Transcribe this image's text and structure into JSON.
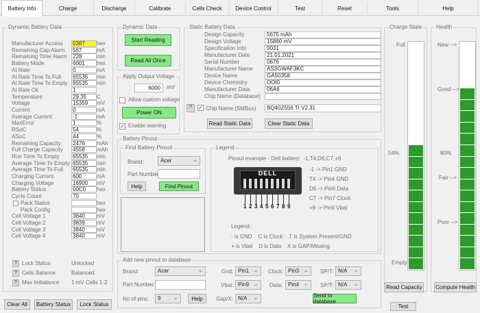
{
  "tabs": [
    "Battery Info",
    "Charge",
    "Discharge",
    "Calibrate",
    "Cells Check",
    "Device Control",
    "Test",
    "Reset",
    "Tools",
    "Help"
  ],
  "dynamic": {
    "title": "Dynamic Battery Data",
    "rows": [
      {
        "label": "Manufacturer Access",
        "value": "0387",
        "unit": "hex",
        "hl": true
      },
      {
        "label": "Remaining Cap Alarm",
        "value": "567",
        "unit": "mA"
      },
      {
        "label": "Remaining Time Alarm",
        "value": "228",
        "unit": "min"
      },
      {
        "label": "Battery Mode",
        "value": "6001",
        "unit": "hex"
      },
      {
        "label": "At Rate",
        "value": "0",
        "unit": "mA"
      },
      {
        "label": "At Rate Time To Full",
        "value": "65535",
        "unit": "min"
      },
      {
        "label": "At Rate Time To Empty",
        "value": "65535",
        "unit": "min"
      },
      {
        "label": "At Rate Ok",
        "value": "1",
        "unit": ""
      },
      {
        "label": "Temperature",
        "value": "29.35",
        "unit": "C"
      },
      {
        "label": "Voltage",
        "value": "15359",
        "unit": "mV"
      },
      {
        "label": "Current",
        "value": "0",
        "unit": "mA"
      },
      {
        "label": "Average Current",
        "value": "-1",
        "unit": "mA"
      },
      {
        "label": "MaxError",
        "value": "1",
        "unit": "%"
      },
      {
        "label": "RSoC",
        "value": "54",
        "unit": "%"
      },
      {
        "label": "ASoC",
        "value": "44",
        "unit": "%"
      },
      {
        "label": "Remaining Capacity",
        "value": "2476",
        "unit": "mAh"
      },
      {
        "label": "Full Charge Capacity",
        "value": "4558",
        "unit": "mAh"
      },
      {
        "label": "Run Time To Empty",
        "value": "65535",
        "unit": "min"
      },
      {
        "label": "Average Time To Empty",
        "value": "65535",
        "unit": "min"
      },
      {
        "label": "Average Time To Full",
        "value": "65535",
        "unit": "min"
      },
      {
        "label": "Charging Current",
        "value": "600",
        "unit": "mA"
      },
      {
        "label": "Charging Voltage",
        "value": "16900",
        "unit": "mV"
      },
      {
        "label": "Battery Status",
        "value": "00C0",
        "unit": "hex"
      },
      {
        "label": "Cycle Count",
        "value": "70",
        "unit": ""
      },
      {
        "label": "Pack Status",
        "value": "",
        "unit": "hex"
      },
      {
        "label": "Pack Config",
        "value": "",
        "unit": "hex"
      },
      {
        "label": "Cell Voltage 1",
        "value": "3840",
        "unit": "mV"
      },
      {
        "label": "Cell Voltage 2",
        "value": "3839",
        "unit": "mV"
      },
      {
        "label": "Cell Voltage 3",
        "value": "3840",
        "unit": "mV"
      },
      {
        "label": "Cell Voltage 4",
        "value": "3840",
        "unit": "mV"
      }
    ],
    "lock_status_label": "Lock Status",
    "lock_status_value": "Unlocked",
    "cells_balance_label": "Cells Balance",
    "cells_balance_value": "Balanced",
    "max_imbalance_label": "Max Imbalance",
    "max_imbalance_value": "1 mV Cells 1-2",
    "qmark": "?"
  },
  "bottom_buttons": {
    "clear_all": "Clear All",
    "battery_status": "Battery Status",
    "lock_status": "Lock Status"
  },
  "dyn_data": {
    "title": "Dynamic Data",
    "start": "Start Reading",
    "read_once": "Read All Once"
  },
  "apply_voltage": {
    "title": "Apply Output Voltage",
    "value": "6000",
    "unit": "mV",
    "allow_custom": "Allow custom voltage",
    "power_on": "Power ON",
    "enable_warning": "Enable warning"
  },
  "static": {
    "title": "Static Battery Data",
    "rows": [
      {
        "label": "Design Capacity",
        "value": "5675 mAh"
      },
      {
        "label": "Design Voltage",
        "value": "15860 mV"
      },
      {
        "label": "Specification Info",
        "value": "0031"
      },
      {
        "label": "Manufacturer Date",
        "value": "21.01.2021"
      },
      {
        "label": "Serial Number",
        "value": "0676"
      },
      {
        "label": "Manufacturer Name",
        "value": "AS3GWAF3KC"
      },
      {
        "label": "Device Name",
        "value": "GA50358"
      },
      {
        "label": "Device Chemistry",
        "value": "OOI0"
      },
      {
        "label": "Manufacturer Data",
        "value": "06A6"
      },
      {
        "label": "Chip Name (Database)",
        "value": ""
      }
    ],
    "chip_smbus_label": "Chip Name (SMBus)",
    "chip_smbus_value": "BQ40Z556 TI V2.31",
    "read_btn": "Read Static Data",
    "clear_btn": "Clear Static Data"
  },
  "pinout": {
    "title": "Battery Pinout",
    "find_title": "Find Battery Pinout",
    "brand_label": "Brand:",
    "brand_value": "Acer",
    "part_label": "Part Number:",
    "part_value": "",
    "help": "Help",
    "find": "Find Pinout",
    "legend_title": "Legend",
    "example": "Pinout example - Dell battery:  -1,T4,D6,C7,+9",
    "connector_label": "DELL",
    "pin_numbers": [
      "1",
      "2",
      "3",
      "4",
      "5",
      "6",
      "7",
      "8",
      "9"
    ],
    "pin_map": [
      "-1 -> Pin1 GND",
      "T4 -> Pin4 GND",
      "D6 -> Pin6 Data",
      "C7 -> Pin7 Clock",
      "+9 -> Pin9 Vbat"
    ],
    "legend_head": "Legend:",
    "legend_lines": [
      "- is GND    C is Clock    T is System Present/GND",
      "+ is Vbat    D is Data    X is GAP/Missing"
    ]
  },
  "addpin": {
    "title": "Add new pinout to database",
    "brand_label": "Brand:",
    "brand_value": "Acer",
    "part_label": "Part Number:",
    "part_value": "",
    "pins_label": "No of pins:",
    "pins_value": "9",
    "help": "Help",
    "gnd_label": "Gnd:",
    "gnd_value": "Pin1",
    "vbat_label": "Vbat:",
    "vbat_value": "Pin9",
    "gapx_label": "Gap/X:",
    "gapx_value": "N/A",
    "clock_label": "Clock:",
    "clock_value": "Pin3",
    "data_label": "Data:",
    "data_value": "Pin4",
    "spt1_label": "SP/T:",
    "spt1_value": "N/A",
    "spt2_label": "SP/T:",
    "spt2_value": "N/A",
    "send": "Send to database"
  },
  "charge_state": {
    "title": "Charge State",
    "full": "Full",
    "empty": "Empty",
    "percent_label": "54%",
    "level": 0.54,
    "read": "Read Capacity",
    "test": "Test"
  },
  "health": {
    "title": "Health",
    "new": "New -->",
    "good": "Good -->",
    "percent_label": "80%",
    "fair": "Fair -->",
    "poor": "Poor -->",
    "level": 0.8,
    "compute": "Compute Health"
  },
  "colors": {
    "accent_green": "#2e9a2e",
    "button_green": "#88e888",
    "highlight": "#ffff00"
  }
}
